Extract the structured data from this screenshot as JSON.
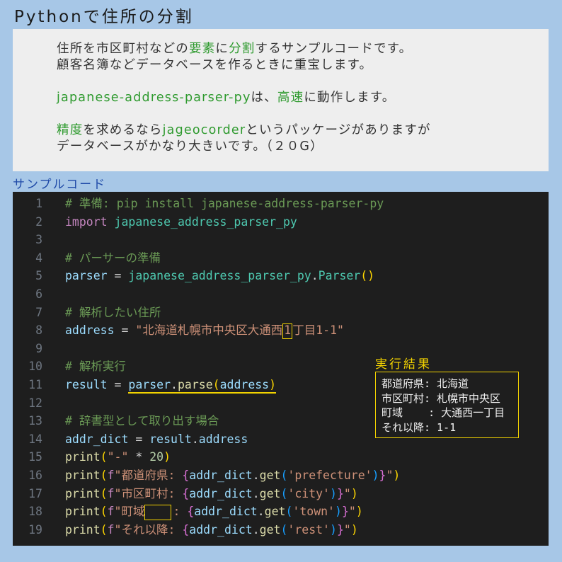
{
  "page_title": "Pythonで住所の分割",
  "intro": {
    "line1": [
      {
        "text": "住所を市区町村などの",
        "hl": false
      },
      {
        "text": "要素",
        "hl": true
      },
      {
        "text": "に",
        "hl": false
      },
      {
        "text": "分割",
        "hl": true
      },
      {
        "text": "するサンプルコードです。",
        "hl": false
      }
    ],
    "line2": "顧客名簿などデータベースを作るときに重宝します。",
    "line3": [
      {
        "text": "japanese-address-parser-py",
        "hl": true
      },
      {
        "text": "は、",
        "hl": false
      },
      {
        "text": "高速",
        "hl": true
      },
      {
        "text": "に動作します。",
        "hl": false
      }
    ],
    "line4": [
      {
        "text": "精度",
        "hl": true
      },
      {
        "text": "を求めるなら",
        "hl": false
      },
      {
        "text": "jageocorder",
        "hl": true
      },
      {
        "text": "というパッケージがありますが",
        "hl": false
      }
    ],
    "line5": "データベースがかなり大きいです。（２０G）"
  },
  "sample_label": "サンプルコード",
  "code_lines": [
    {
      "n": "1",
      "tokens": [
        [
          "c",
          "# 準備: pip install japanese-address-parser-py"
        ]
      ]
    },
    {
      "n": "2",
      "tokens": [
        [
          "k",
          "import"
        ],
        [
          "d",
          " "
        ],
        [
          "t",
          "japanese_address_parser_py"
        ]
      ]
    },
    {
      "n": "3",
      "tokens": []
    },
    {
      "n": "4",
      "tokens": [
        [
          "c",
          "# パーサーの準備"
        ]
      ]
    },
    {
      "n": "5",
      "tokens": [
        [
          "v",
          "parser"
        ],
        [
          "d",
          " = "
        ],
        [
          "t",
          "japanese_address_parser_py"
        ],
        [
          "d",
          "."
        ],
        [
          "t",
          "Parser"
        ],
        [
          "p1",
          "()"
        ]
      ]
    },
    {
      "n": "6",
      "tokens": []
    },
    {
      "n": "7",
      "tokens": [
        [
          "c",
          "# 解析したい住所"
        ]
      ]
    },
    {
      "n": "8",
      "tokens": [
        [
          "v",
          "address"
        ],
        [
          "d",
          " = "
        ],
        [
          "s",
          "\"北海道札幌市中央区大通西"
        ],
        [
          "sbox",
          "1"
        ],
        [
          "s",
          "丁目1-1\""
        ]
      ]
    },
    {
      "n": "9",
      "tokens": []
    },
    {
      "n": "10",
      "tokens": [
        [
          "c",
          "# 解析実行"
        ]
      ]
    },
    {
      "n": "11",
      "tokens": [
        [
          "v",
          "result"
        ],
        [
          "d",
          " = "
        ],
        [
          "ulv",
          "parser"
        ],
        [
          "uld",
          "."
        ],
        [
          "ulf",
          "parse"
        ],
        [
          "ulp1",
          "("
        ],
        [
          "ulv",
          "address"
        ],
        [
          "ulp1",
          ")"
        ]
      ]
    },
    {
      "n": "12",
      "tokens": []
    },
    {
      "n": "13",
      "tokens": [
        [
          "c",
          "# 辞書型として取り出す場合"
        ]
      ]
    },
    {
      "n": "14",
      "tokens": [
        [
          "v",
          "addr_dict"
        ],
        [
          "d",
          " = "
        ],
        [
          "v",
          "result"
        ],
        [
          "d",
          "."
        ],
        [
          "v",
          "address"
        ]
      ]
    },
    {
      "n": "15",
      "tokens": [
        [
          "f",
          "print"
        ],
        [
          "p1",
          "("
        ],
        [
          "s",
          "\"-\""
        ],
        [
          "d",
          " * "
        ],
        [
          "n",
          "20"
        ],
        [
          "p1",
          ")"
        ]
      ]
    },
    {
      "n": "16",
      "tokens": [
        [
          "f",
          "print"
        ],
        [
          "p1",
          "("
        ],
        [
          "k",
          "f"
        ],
        [
          "s",
          "\"都道府県: "
        ],
        [
          "p2",
          "{"
        ],
        [
          "v",
          "addr_dict"
        ],
        [
          "d",
          "."
        ],
        [
          "f",
          "get"
        ],
        [
          "p3",
          "("
        ],
        [
          "s",
          "'prefecture'"
        ],
        [
          "p3",
          ")"
        ],
        [
          "p2",
          "}"
        ],
        [
          "s",
          "\""
        ],
        [
          "p1",
          ")"
        ]
      ]
    },
    {
      "n": "17",
      "tokens": [
        [
          "f",
          "print"
        ],
        [
          "p1",
          "("
        ],
        [
          "k",
          "f"
        ],
        [
          "s",
          "\"市区町村: "
        ],
        [
          "p2",
          "{"
        ],
        [
          "v",
          "addr_dict"
        ],
        [
          "d",
          "."
        ],
        [
          "f",
          "get"
        ],
        [
          "p3",
          "("
        ],
        [
          "s",
          "'city'"
        ],
        [
          "p3",
          ")"
        ],
        [
          "p2",
          "}"
        ],
        [
          "s",
          "\""
        ],
        [
          "p1",
          ")"
        ]
      ]
    },
    {
      "n": "18",
      "tokens": [
        [
          "f",
          "print"
        ],
        [
          "p1",
          "("
        ],
        [
          "k",
          "f"
        ],
        [
          "s",
          "\"町域"
        ],
        [
          "sboxw",
          "    "
        ],
        [
          "s",
          ": "
        ],
        [
          "p2",
          "{"
        ],
        [
          "v",
          "addr_dict"
        ],
        [
          "d",
          "."
        ],
        [
          "f",
          "get"
        ],
        [
          "p3",
          "("
        ],
        [
          "s",
          "'town'"
        ],
        [
          "p3",
          ")"
        ],
        [
          "p2",
          "}"
        ],
        [
          "s",
          "\""
        ],
        [
          "p1",
          ")"
        ]
      ]
    },
    {
      "n": "19",
      "tokens": [
        [
          "f",
          "print"
        ],
        [
          "p1",
          "("
        ],
        [
          "k",
          "f"
        ],
        [
          "s",
          "\"それ以降: "
        ],
        [
          "p2",
          "{"
        ],
        [
          "v",
          "addr_dict"
        ],
        [
          "d",
          "."
        ],
        [
          "f",
          "get"
        ],
        [
          "p3",
          "("
        ],
        [
          "s",
          "'rest'"
        ],
        [
          "p3",
          ")"
        ],
        [
          "p2",
          "}"
        ],
        [
          "s",
          "\""
        ],
        [
          "p1",
          ")"
        ]
      ]
    }
  ],
  "result": {
    "title": "実行結果",
    "lines": [
      "都道府県: 北海道",
      "市区町村: 札幌市中央区",
      "町域    : 大通西一丁目",
      "それ以降: 1-1"
    ]
  },
  "colors": {
    "background": "#a7c7e7",
    "highlight_green": "#2e9a2e",
    "accent_yellow": "#f2d200",
    "editor_bg": "#1e1e1e"
  }
}
